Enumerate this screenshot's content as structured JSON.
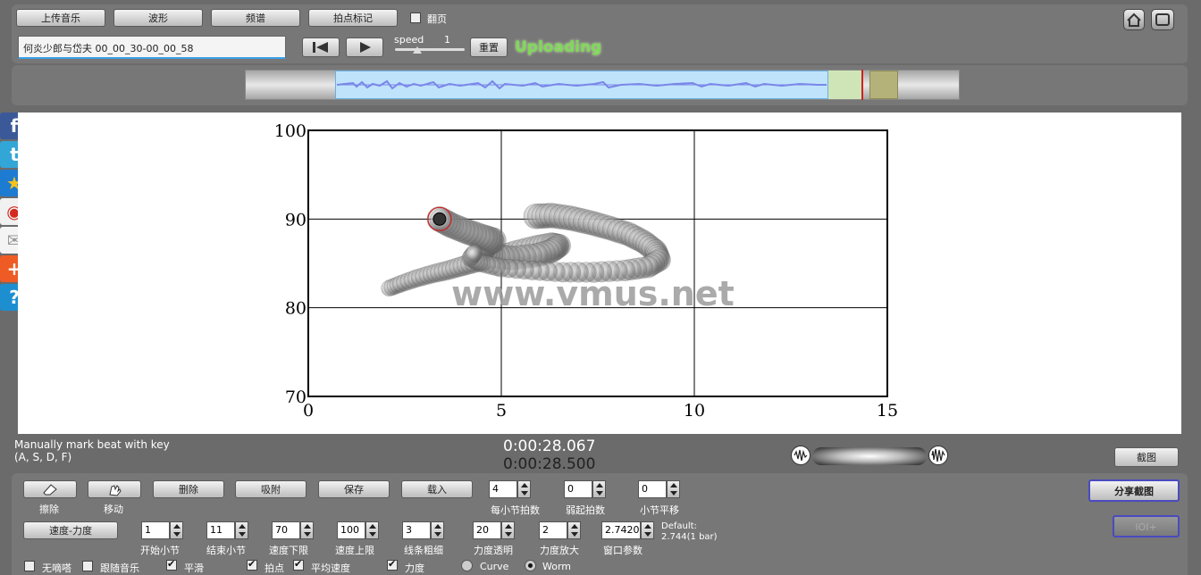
{
  "toolbar": {
    "upload_music": "上传音乐",
    "waveform": "波形",
    "spectrum": "频谱",
    "beat_mark": "拍点标记",
    "page_flip": "翻页",
    "file_name": "何炎少郎与岱夫 00_00_30-00_00_58",
    "speed_label": "speed",
    "speed_value": "1",
    "reset": "重置",
    "status": "Uploading"
  },
  "plot": {
    "watermark": "www.vmus.net",
    "x_ticks": [
      "0",
      "5",
      "10",
      "15"
    ],
    "y_ticks": [
      "100",
      "90",
      "80",
      "70"
    ]
  },
  "chart_data": {
    "type": "scatter",
    "xlim": [
      0,
      15
    ],
    "ylim": [
      70,
      100
    ],
    "grid": true,
    "x_ticks": [
      0,
      5,
      10,
      15
    ],
    "y_ticks": [
      70,
      80,
      90,
      100
    ],
    "series": [
      {
        "points": [
          [
            2.1,
            82.2
          ],
          [
            2.4,
            82.7
          ],
          [
            2.8,
            83.3
          ],
          [
            3.2,
            83.8
          ],
          [
            3.6,
            84.2
          ],
          [
            4.0,
            84.7
          ],
          [
            4.4,
            85.2
          ],
          [
            4.9,
            85.8
          ],
          [
            5.4,
            86.4
          ],
          [
            5.9,
            86.9
          ],
          [
            6.3,
            87.2
          ],
          [
            6.5,
            87.0
          ],
          [
            6.3,
            86.4
          ],
          [
            5.9,
            85.9
          ],
          [
            5.3,
            85.6
          ],
          [
            4.8,
            85.8
          ],
          [
            4.5,
            86.4
          ],
          [
            4.6,
            87.2
          ],
          [
            4.8,
            87.6
          ],
          [
            4.5,
            88.0
          ],
          [
            4.1,
            88.6
          ],
          [
            3.7,
            89.3
          ],
          [
            3.4,
            90.0
          ],
          [
            5.9,
            90.3
          ],
          [
            6.3,
            90.4
          ],
          [
            6.8,
            90.1
          ],
          [
            7.3,
            89.6
          ],
          [
            7.8,
            89.0
          ],
          [
            8.3,
            88.3
          ],
          [
            8.7,
            87.4
          ],
          [
            9.0,
            86.4
          ],
          [
            9.1,
            85.4
          ],
          [
            8.8,
            84.6
          ],
          [
            8.2,
            84.2
          ],
          [
            7.4,
            84.0
          ],
          [
            6.6,
            84.0
          ],
          [
            5.8,
            84.2
          ],
          [
            5.0,
            84.5
          ],
          [
            4.5,
            85.0
          ],
          [
            4.2,
            85.6
          ],
          [
            4.3,
            86.2
          ]
        ],
        "current_point": [
          3.4,
          90.0
        ]
      }
    ]
  },
  "info": {
    "hint_line1": "Manually mark beat with key",
    "hint_line2": "(A, S, D, F)",
    "time_current": "0:00:28.067",
    "time_total": "0:00:28.500",
    "screenshot": "截图"
  },
  "controls": {
    "erase": "擦除",
    "move": "移动",
    "delete": "删除",
    "snap": "吸附",
    "save": "保存",
    "load": "载入",
    "beats_per_bar_label": "每小节拍数",
    "beats_per_bar": "4",
    "pickup_label": "弱起拍数",
    "pickup": "0",
    "bar_shift_label": "小节平移",
    "bar_shift": "0",
    "share_screenshot": "分享截图",
    "ioi": "IOI+",
    "tempo_dynamics": "速度-力度",
    "start_bar_label": "开始小节",
    "start_bar": "1",
    "end_bar_label": "结束小节",
    "end_bar": "11",
    "tempo_min_label": "速度下限",
    "tempo_min": "70",
    "tempo_max_label": "速度上限",
    "tempo_max": "100",
    "line_width_label": "线条粗细",
    "line_width": "3",
    "dyn_alpha_label": "力度透明",
    "dyn_alpha": "20",
    "dyn_scale_label": "力度放大",
    "dyn_scale": "2",
    "window_label": "窗口参数",
    "window": "2.7420",
    "default_line1": "Default:",
    "default_line2": "2.744(1 bar)",
    "no_squeak": "无嘀嗒",
    "follow_music": "跟随音乐",
    "smooth": "平滑",
    "beat_point": "拍点",
    "avg_tempo": "平均速度",
    "dynamics": "力度",
    "curve": "Curve",
    "worm": "Worm"
  },
  "colors": {
    "accent_green": "#7ed957",
    "waveform": "#7a86e8",
    "selection": "#bfe3fb"
  }
}
